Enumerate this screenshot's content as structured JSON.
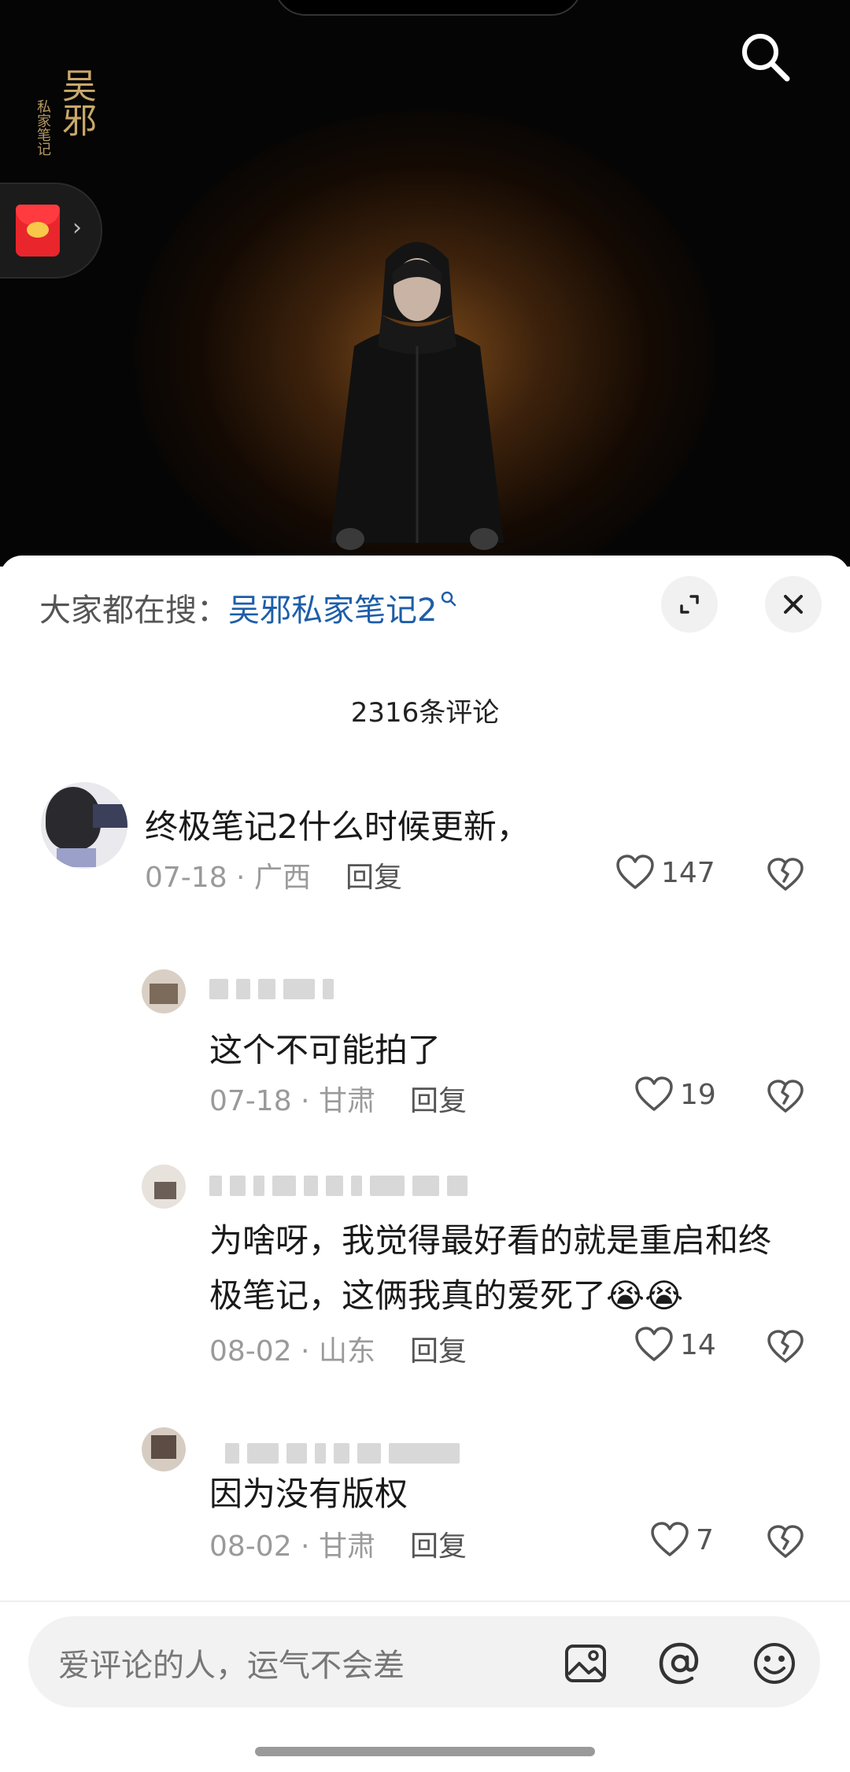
{
  "search_suggestion": {
    "prefix": "大家都在搜：",
    "term": "吴邪私家笔记2"
  },
  "video": {
    "logo_text": "吴邪",
    "logo_subtext": "私家笔记"
  },
  "comment_count": "2316条评论",
  "comments": [
    {
      "text": "终极笔记2什么时候更新，",
      "date": "07-18",
      "location": "广西",
      "reply_label": "回复",
      "likes": "147"
    },
    {
      "text": "这个不可能拍了",
      "date": "07-18",
      "location": "甘肃",
      "reply_label": "回复",
      "likes": "19"
    },
    {
      "text_line1": "为啥呀，我觉得最好看的就是重启和终",
      "text_line2": "极笔记，这俩我真的爱死了😭😭",
      "date": "08-02",
      "location": "山东",
      "reply_label": "回复",
      "likes": "14"
    },
    {
      "text": "因为没有版权",
      "date": "08-02",
      "location": "甘肃",
      "reply_label": "回复",
      "likes": "7"
    }
  ],
  "input": {
    "placeholder": "爱评论的人，运气不会差"
  },
  "colors": {
    "accent_link": "#1e5ea8",
    "red_packet": "#e8262b"
  }
}
